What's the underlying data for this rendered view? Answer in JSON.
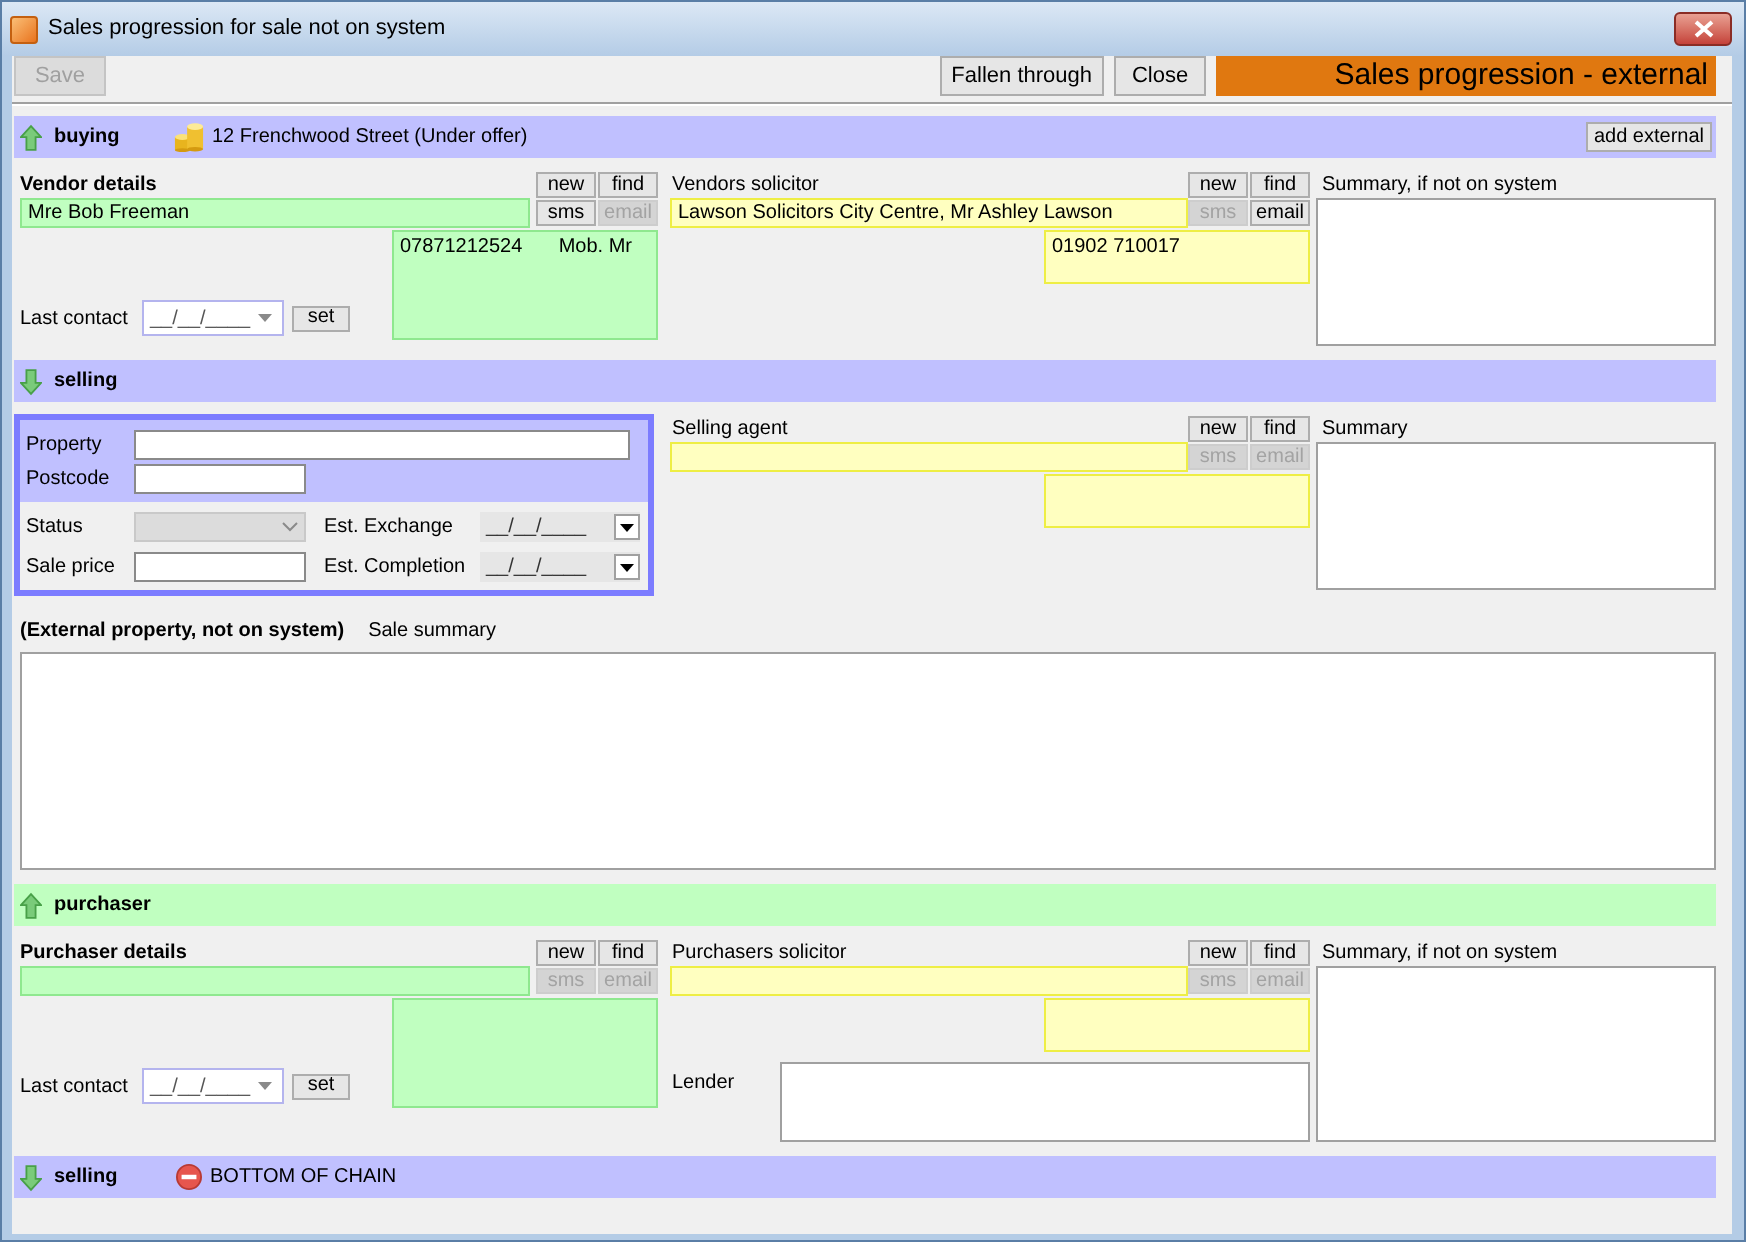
{
  "window": {
    "title": "Sales progression for sale not on system"
  },
  "toolbar": {
    "left_buttons": [
      {
        "label": "Save",
        "disabled": true
      }
    ],
    "right_buttons": [
      {
        "label": "Fallen through",
        "disabled": false
      },
      {
        "label": "Close",
        "disabled": false
      }
    ],
    "banner": "Sales progression - external"
  },
  "sections": [
    {
      "kind": "chain_bar",
      "label": "buying",
      "upward": true,
      "color": "#c0c0ff",
      "note": {
        "kind": "property",
        "text": "12 Frenchwood Street (Under offer)"
      },
      "button": "add external"
    },
    {
      "kind": "parties",
      "left": {
        "kind": "client",
        "title": "Vendor details",
        "name": "Mre Bob Freeman",
        "buttons": [
          {
            "label": "new",
            "disabled": false
          },
          {
            "label": "find",
            "disabled": false
          },
          {
            "label": "sms",
            "disabled": false
          },
          {
            "label": "email",
            "disabled": true
          }
        ],
        "phone": {
          "number": "07871212524",
          "type": "Mob. Mr"
        },
        "last_contact": {
          "label": "Last contact",
          "date": "__/__/____",
          "button": "set"
        }
      },
      "middle": {
        "kind": "professional",
        "title": "Vendors solicitor",
        "name": "Lawson Solicitors City Centre, Mr Ashley Lawson",
        "buttons": [
          {
            "label": "new",
            "disabled": false
          },
          {
            "label": "find",
            "disabled": false
          },
          {
            "label": "sms",
            "disabled": true
          },
          {
            "label": "email",
            "disabled": false
          }
        ],
        "phone": {
          "number": "01902 710017"
        }
      },
      "summary": {
        "label": "Summary, if not on system"
      }
    },
    {
      "kind": "chain_bar",
      "label": "selling",
      "upward": false,
      "color": "#c0c0ff"
    },
    {
      "kind": "selling",
      "property": {
        "address_fields": [
          {
            "label": "Property",
            "wide": true
          },
          {
            "label": "Postcode",
            "wide": false
          }
        ],
        "sale_fields": [
          {
            "label": "Status",
            "kind": "select",
            "disabled": true
          },
          {
            "label": "Est. Exchange",
            "kind": "date",
            "date": "__/__/____",
            "disabled": false
          },
          {
            "label": "Sale price",
            "kind": "text",
            "disabled": false
          },
          {
            "label": "Est. Completion",
            "kind": "date",
            "date": "__/__/____",
            "disabled": false
          }
        ]
      },
      "middle": {
        "kind": "professional",
        "title": "Selling agent",
        "buttons": [
          {
            "label": "new",
            "disabled": false
          },
          {
            "label": "find",
            "disabled": false
          },
          {
            "label": "sms",
            "disabled": true
          },
          {
            "label": "email",
            "disabled": true
          }
        ]
      },
      "summary": {
        "label": "Summary"
      }
    },
    {
      "kind": "sale_summary",
      "title": "(External property, not on system)",
      "label": "Sale summary"
    },
    {
      "kind": "chain_bar",
      "label": "purchaser",
      "upward": true,
      "color": "#c0ffc0"
    },
    {
      "kind": "parties",
      "left": {
        "kind": "client",
        "title": "Purchaser details",
        "buttons": [
          {
            "label": "new",
            "disabled": false
          },
          {
            "label": "find",
            "disabled": false
          },
          {
            "label": "sms",
            "disabled": true
          },
          {
            "label": "email",
            "disabled": true
          }
        ],
        "last_contact": {
          "label": "Last contact",
          "date": "__/__/____",
          "button": "set"
        }
      },
      "middle": {
        "kind": "professional",
        "title": "Purchasers solicitor",
        "buttons": [
          {
            "label": "new",
            "disabled": false
          },
          {
            "label": "find",
            "disabled": false
          },
          {
            "label": "sms",
            "disabled": true
          },
          {
            "label": "email",
            "disabled": true
          }
        ],
        "lender": {
          "label": "Lender"
        }
      },
      "summary": {
        "label": "Summary, if not on system"
      }
    },
    {
      "kind": "chain_bar",
      "label": "selling",
      "upward": false,
      "color": "#c0c0ff",
      "note": {
        "kind": "end_of_chain",
        "text": "BOTTOM OF CHAIN"
      }
    }
  ]
}
